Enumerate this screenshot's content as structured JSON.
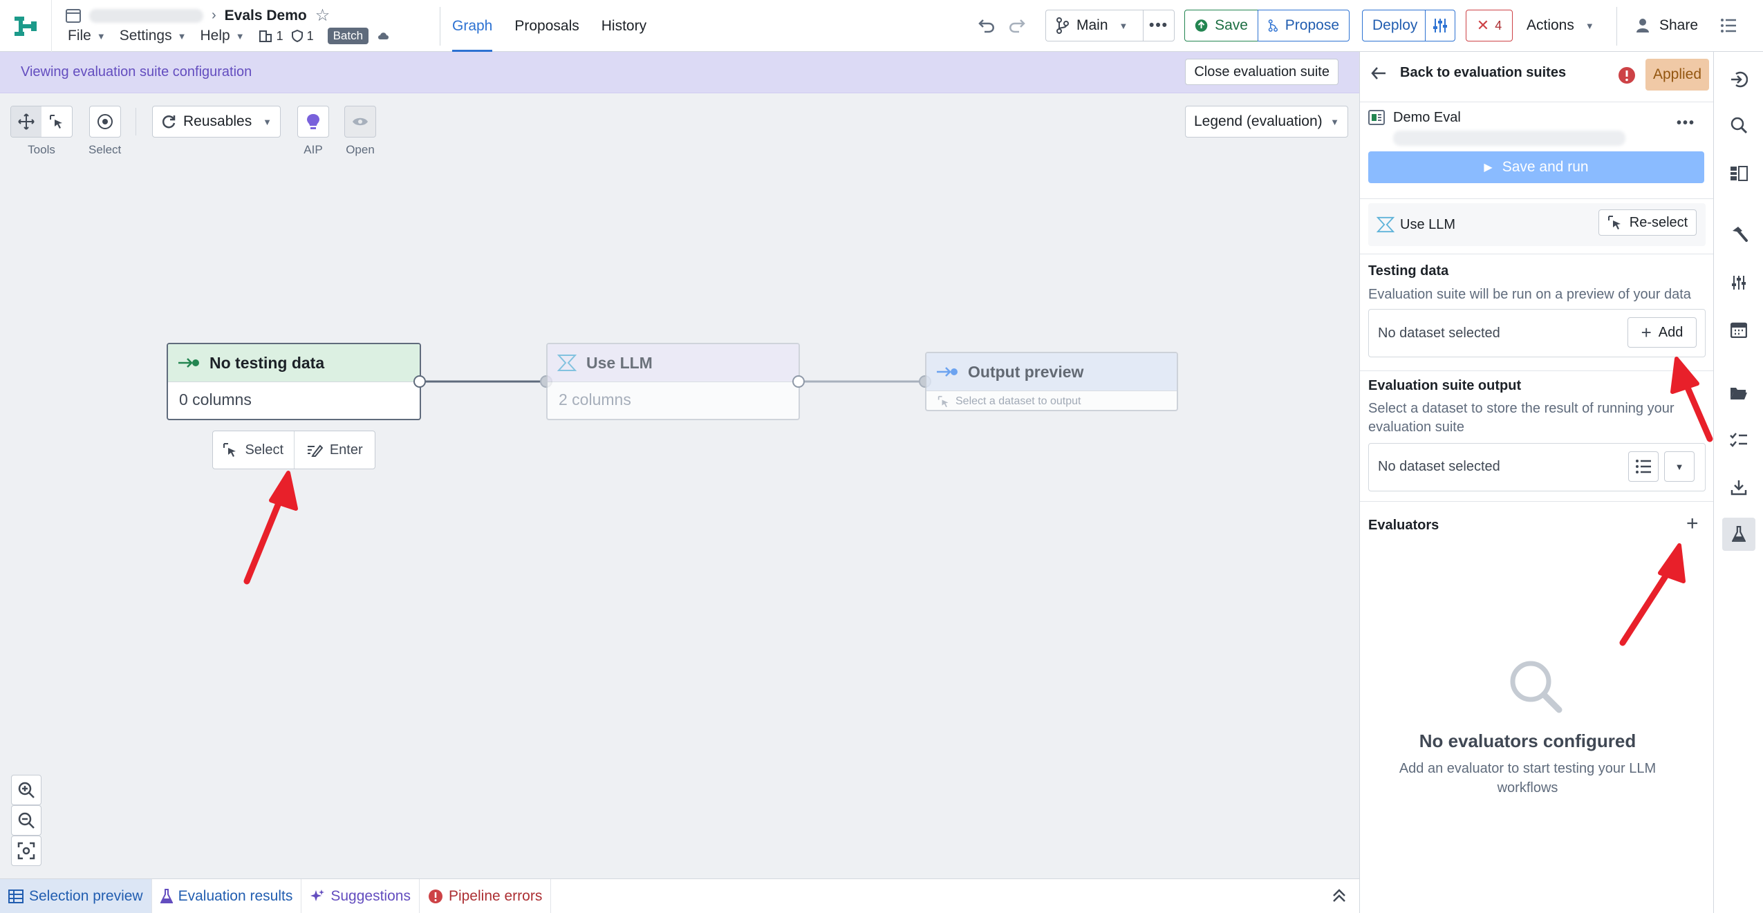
{
  "header": {
    "project_title": "Evals Demo",
    "menus": [
      "File",
      "Settings",
      "Help"
    ],
    "build_count": "1",
    "check_count": "1",
    "batch_label": "Batch",
    "tabs": [
      "Graph",
      "Proposals",
      "History"
    ],
    "active_tab": "Graph",
    "branch": "Main",
    "save_label": "Save",
    "propose_label": "Propose",
    "deploy_label": "Deploy",
    "error_count": "4",
    "actions_label": "Actions",
    "share_label": "Share"
  },
  "banner": {
    "text": "Viewing evaluation suite configuration",
    "close_label": "Close evaluation suite"
  },
  "toolbar": {
    "tools_label": "Tools",
    "select_label": "Select",
    "reusables_label": "Reusables",
    "aip_label": "AIP",
    "open_label": "Open",
    "legend_label": "Legend (evaluation)"
  },
  "graph": {
    "nodes": [
      {
        "title": "No testing data",
        "subtitle": "0 columns"
      },
      {
        "title": "Use LLM",
        "subtitle": "2 columns"
      },
      {
        "title": "Output preview",
        "subtitle": "Select a dataset to output"
      }
    ],
    "node_actions": {
      "select": "Select",
      "enter": "Enter"
    }
  },
  "bottom_tabs": [
    "Selection preview",
    "Evaluation results",
    "Suggestions",
    "Pipeline errors"
  ],
  "panel": {
    "back_label": "Back to evaluation suites",
    "applied_label": "Applied",
    "suite_name": "Demo Eval",
    "save_run_label": "Save and run",
    "llm_label": "Use LLM",
    "reselect_label": "Re-select",
    "testing_title": "Testing data",
    "testing_desc": "Evaluation suite will be run on a preview of your data",
    "no_dataset": "No dataset selected",
    "add_label": "Add",
    "output_title": "Evaluation suite output",
    "output_desc_1": "Select a dataset to store the result of running your",
    "output_desc_2": "evaluation suite",
    "evaluators_title": "Evaluators",
    "empty_title": "No evaluators configured",
    "empty_desc_1": "Add an evaluator to start testing your LLM",
    "empty_desc_2": "workflows"
  },
  "colors": {
    "accent_blue": "#2d72d2",
    "success_green": "#238551",
    "banner_purple": "#634dbf",
    "annotation_red": "#e8202a",
    "applied_orange": "#f0c9a6"
  }
}
